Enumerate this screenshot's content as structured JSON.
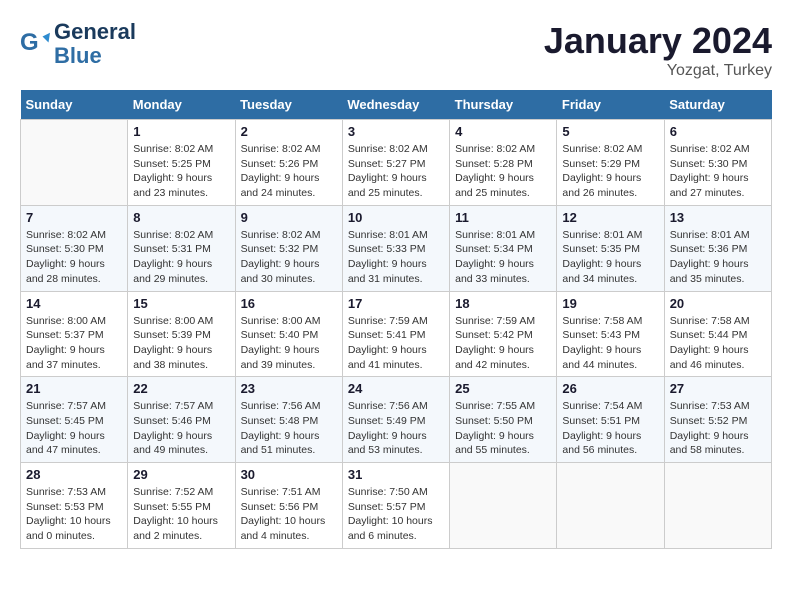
{
  "header": {
    "logo_line1": "General",
    "logo_line2": "Blue",
    "month": "January 2024",
    "location": "Yozgat, Turkey"
  },
  "weekdays": [
    "Sunday",
    "Monday",
    "Tuesday",
    "Wednesday",
    "Thursday",
    "Friday",
    "Saturday"
  ],
  "weeks": [
    [
      {
        "day": "",
        "sunrise": "",
        "sunset": "",
        "daylight": ""
      },
      {
        "day": "1",
        "sunrise": "Sunrise: 8:02 AM",
        "sunset": "Sunset: 5:25 PM",
        "daylight": "Daylight: 9 hours and 23 minutes."
      },
      {
        "day": "2",
        "sunrise": "Sunrise: 8:02 AM",
        "sunset": "Sunset: 5:26 PM",
        "daylight": "Daylight: 9 hours and 24 minutes."
      },
      {
        "day": "3",
        "sunrise": "Sunrise: 8:02 AM",
        "sunset": "Sunset: 5:27 PM",
        "daylight": "Daylight: 9 hours and 25 minutes."
      },
      {
        "day": "4",
        "sunrise": "Sunrise: 8:02 AM",
        "sunset": "Sunset: 5:28 PM",
        "daylight": "Daylight: 9 hours and 25 minutes."
      },
      {
        "day": "5",
        "sunrise": "Sunrise: 8:02 AM",
        "sunset": "Sunset: 5:29 PM",
        "daylight": "Daylight: 9 hours and 26 minutes."
      },
      {
        "day": "6",
        "sunrise": "Sunrise: 8:02 AM",
        "sunset": "Sunset: 5:30 PM",
        "daylight": "Daylight: 9 hours and 27 minutes."
      }
    ],
    [
      {
        "day": "7",
        "sunrise": "Sunrise: 8:02 AM",
        "sunset": "Sunset: 5:30 PM",
        "daylight": "Daylight: 9 hours and 28 minutes."
      },
      {
        "day": "8",
        "sunrise": "Sunrise: 8:02 AM",
        "sunset": "Sunset: 5:31 PM",
        "daylight": "Daylight: 9 hours and 29 minutes."
      },
      {
        "day": "9",
        "sunrise": "Sunrise: 8:02 AM",
        "sunset": "Sunset: 5:32 PM",
        "daylight": "Daylight: 9 hours and 30 minutes."
      },
      {
        "day": "10",
        "sunrise": "Sunrise: 8:01 AM",
        "sunset": "Sunset: 5:33 PM",
        "daylight": "Daylight: 9 hours and 31 minutes."
      },
      {
        "day": "11",
        "sunrise": "Sunrise: 8:01 AM",
        "sunset": "Sunset: 5:34 PM",
        "daylight": "Daylight: 9 hours and 33 minutes."
      },
      {
        "day": "12",
        "sunrise": "Sunrise: 8:01 AM",
        "sunset": "Sunset: 5:35 PM",
        "daylight": "Daylight: 9 hours and 34 minutes."
      },
      {
        "day": "13",
        "sunrise": "Sunrise: 8:01 AM",
        "sunset": "Sunset: 5:36 PM",
        "daylight": "Daylight: 9 hours and 35 minutes."
      }
    ],
    [
      {
        "day": "14",
        "sunrise": "Sunrise: 8:00 AM",
        "sunset": "Sunset: 5:37 PM",
        "daylight": "Daylight: 9 hours and 37 minutes."
      },
      {
        "day": "15",
        "sunrise": "Sunrise: 8:00 AM",
        "sunset": "Sunset: 5:39 PM",
        "daylight": "Daylight: 9 hours and 38 minutes."
      },
      {
        "day": "16",
        "sunrise": "Sunrise: 8:00 AM",
        "sunset": "Sunset: 5:40 PM",
        "daylight": "Daylight: 9 hours and 39 minutes."
      },
      {
        "day": "17",
        "sunrise": "Sunrise: 7:59 AM",
        "sunset": "Sunset: 5:41 PM",
        "daylight": "Daylight: 9 hours and 41 minutes."
      },
      {
        "day": "18",
        "sunrise": "Sunrise: 7:59 AM",
        "sunset": "Sunset: 5:42 PM",
        "daylight": "Daylight: 9 hours and 42 minutes."
      },
      {
        "day": "19",
        "sunrise": "Sunrise: 7:58 AM",
        "sunset": "Sunset: 5:43 PM",
        "daylight": "Daylight: 9 hours and 44 minutes."
      },
      {
        "day": "20",
        "sunrise": "Sunrise: 7:58 AM",
        "sunset": "Sunset: 5:44 PM",
        "daylight": "Daylight: 9 hours and 46 minutes."
      }
    ],
    [
      {
        "day": "21",
        "sunrise": "Sunrise: 7:57 AM",
        "sunset": "Sunset: 5:45 PM",
        "daylight": "Daylight: 9 hours and 47 minutes."
      },
      {
        "day": "22",
        "sunrise": "Sunrise: 7:57 AM",
        "sunset": "Sunset: 5:46 PM",
        "daylight": "Daylight: 9 hours and 49 minutes."
      },
      {
        "day": "23",
        "sunrise": "Sunrise: 7:56 AM",
        "sunset": "Sunset: 5:48 PM",
        "daylight": "Daylight: 9 hours and 51 minutes."
      },
      {
        "day": "24",
        "sunrise": "Sunrise: 7:56 AM",
        "sunset": "Sunset: 5:49 PM",
        "daylight": "Daylight: 9 hours and 53 minutes."
      },
      {
        "day": "25",
        "sunrise": "Sunrise: 7:55 AM",
        "sunset": "Sunset: 5:50 PM",
        "daylight": "Daylight: 9 hours and 55 minutes."
      },
      {
        "day": "26",
        "sunrise": "Sunrise: 7:54 AM",
        "sunset": "Sunset: 5:51 PM",
        "daylight": "Daylight: 9 hours and 56 minutes."
      },
      {
        "day": "27",
        "sunrise": "Sunrise: 7:53 AM",
        "sunset": "Sunset: 5:52 PM",
        "daylight": "Daylight: 9 hours and 58 minutes."
      }
    ],
    [
      {
        "day": "28",
        "sunrise": "Sunrise: 7:53 AM",
        "sunset": "Sunset: 5:53 PM",
        "daylight": "Daylight: 10 hours and 0 minutes."
      },
      {
        "day": "29",
        "sunrise": "Sunrise: 7:52 AM",
        "sunset": "Sunset: 5:55 PM",
        "daylight": "Daylight: 10 hours and 2 minutes."
      },
      {
        "day": "30",
        "sunrise": "Sunrise: 7:51 AM",
        "sunset": "Sunset: 5:56 PM",
        "daylight": "Daylight: 10 hours and 4 minutes."
      },
      {
        "day": "31",
        "sunrise": "Sunrise: 7:50 AM",
        "sunset": "Sunset: 5:57 PM",
        "daylight": "Daylight: 10 hours and 6 minutes."
      },
      {
        "day": "",
        "sunrise": "",
        "sunset": "",
        "daylight": ""
      },
      {
        "day": "",
        "sunrise": "",
        "sunset": "",
        "daylight": ""
      },
      {
        "day": "",
        "sunrise": "",
        "sunset": "",
        "daylight": ""
      }
    ]
  ]
}
